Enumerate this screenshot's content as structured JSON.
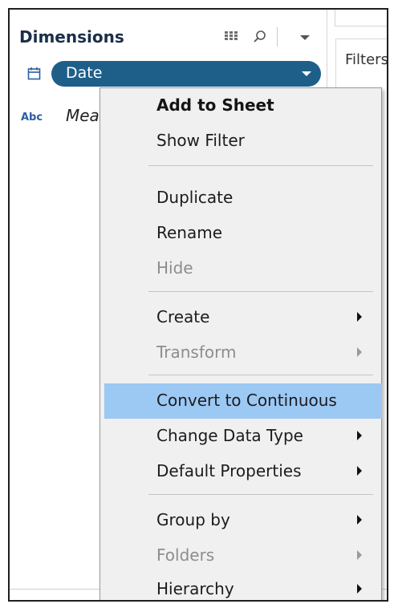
{
  "data_pane": {
    "dimensions_title": "Dimensions",
    "date_field": "Date",
    "measure_field": "Mea",
    "abc_label": "Abc"
  },
  "worksheet": {
    "filters_label": "Filters"
  },
  "context_menu": {
    "add_to_sheet": "Add to Sheet",
    "show_filter": "Show Filter",
    "duplicate": "Duplicate",
    "rename": "Rename",
    "hide": "Hide",
    "create": "Create",
    "transform": "Transform",
    "convert_to_continuous": "Convert to Continuous",
    "change_data_type": "Change Data Type",
    "default_properties": "Default Properties",
    "group_by": "Group by",
    "folders": "Folders",
    "hierarchy": "Hierarchy"
  },
  "icons": {
    "calendar": "calendar-icon",
    "grid": "grid-view-icon",
    "search": "search-icon",
    "dropdown": "chevron-down-icon",
    "submenu": "submenu-arrow-icon"
  },
  "colors": {
    "pill": "#1e5f8a",
    "highlight": "#9cc8f4",
    "menu_bg": "#f0f0f0",
    "title": "#1a2e4a"
  }
}
